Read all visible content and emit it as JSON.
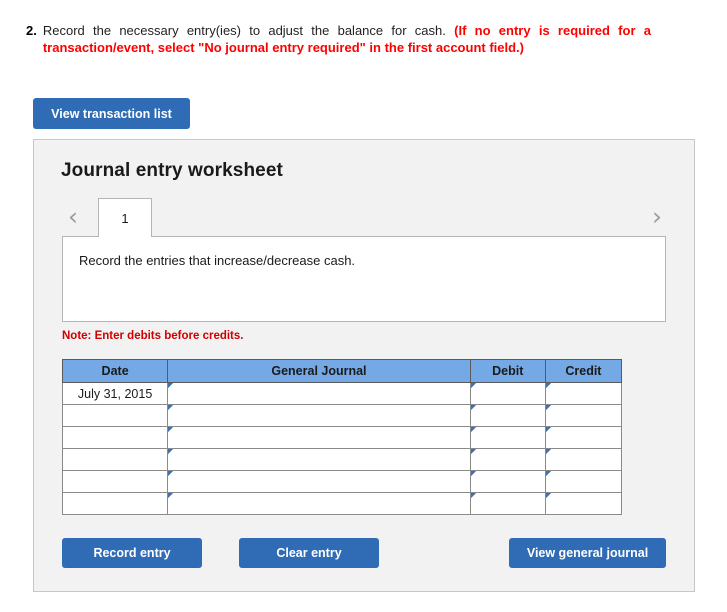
{
  "question": {
    "number": "2.",
    "main_text": "Record the necessary entry(ies) to adjust the balance for cash.",
    "note_text": "(If no entry is required for a transaction/event, select \"No journal entry required\" in the first account field.)"
  },
  "toolbar": {
    "view_transaction_list_label": "View transaction list"
  },
  "worksheet": {
    "title": "Journal entry worksheet",
    "prev_chevron": "‹",
    "next_chevron": "›",
    "tabs": [
      {
        "label": "1",
        "active": true
      }
    ],
    "description": "Record the entries that increase/decrease cash.",
    "note": "Note: Enter debits before credits."
  },
  "table": {
    "headers": [
      "Date",
      "General Journal",
      "Debit",
      "Credit"
    ],
    "rows": [
      {
        "date": "July 31, 2015",
        "general_journal": "",
        "debit": "",
        "credit": ""
      },
      {
        "date": "",
        "general_journal": "",
        "debit": "",
        "credit": ""
      },
      {
        "date": "",
        "general_journal": "",
        "debit": "",
        "credit": ""
      },
      {
        "date": "",
        "general_journal": "",
        "debit": "",
        "credit": ""
      },
      {
        "date": "",
        "general_journal": "",
        "debit": "",
        "credit": ""
      },
      {
        "date": "",
        "general_journal": "",
        "debit": "",
        "credit": ""
      }
    ]
  },
  "actions": {
    "record_entry_label": "Record entry",
    "clear_entry_label": "Clear entry",
    "view_general_journal_label": "View general journal"
  },
  "colors": {
    "button_blue": "#2f6cb5",
    "header_blue": "#74a9e6",
    "cell_border_blue": "#3a72b8",
    "panel_gray": "#f2f2f2",
    "note_red": "#d00000",
    "question_red": "#ff0000"
  }
}
